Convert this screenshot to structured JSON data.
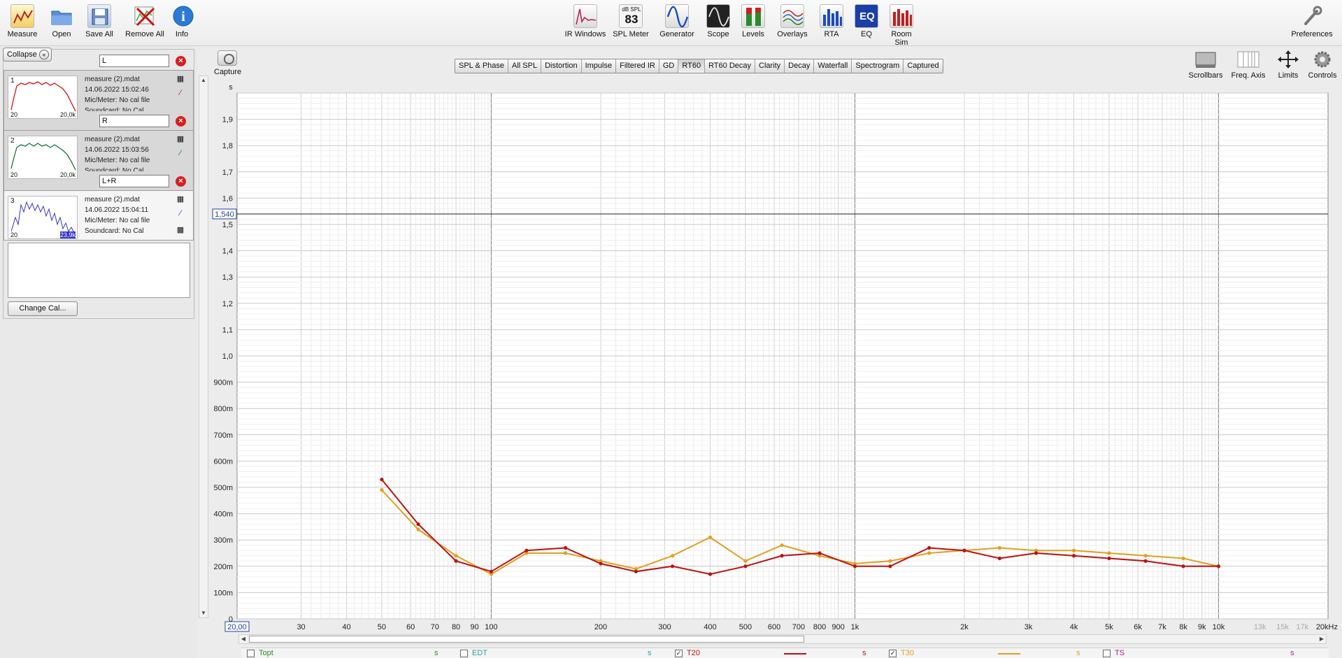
{
  "toolbar": {
    "left": [
      {
        "label": "Measure",
        "icon": "measure-icon"
      },
      {
        "label": "Open",
        "icon": "folder-icon"
      },
      {
        "label": "Save All",
        "icon": "save-icon"
      },
      {
        "label": "Remove All",
        "icon": "remove-all-icon"
      },
      {
        "label": "Info",
        "icon": "info-icon"
      }
    ],
    "center": [
      {
        "label": "IR Windows",
        "icon": "ir-windows-icon"
      },
      {
        "label": "SPL Meter",
        "icon": "spl-meter-icon",
        "badge_top": "dB SPL",
        "badge_value": "83"
      },
      {
        "label": "Generator",
        "icon": "generator-icon"
      },
      {
        "label": "Scope",
        "icon": "scope-icon"
      },
      {
        "label": "Levels",
        "icon": "levels-icon"
      },
      {
        "label": "Overlays",
        "icon": "overlays-icon"
      },
      {
        "label": "RTA",
        "icon": "rta-icon"
      },
      {
        "label": "EQ",
        "icon": "eq-icon"
      },
      {
        "label": "Room Sim",
        "icon": "room-sim-icon"
      }
    ],
    "preferences": "Preferences"
  },
  "left_panel": {
    "collapse_label": "Collapse",
    "measurements": [
      {
        "number": "1",
        "name": "L",
        "file": "measure (2).mdat",
        "date": "14.06.2022 15:02:46",
        "mic": "Mic/Meter: No cal file",
        "soundcard": "Soundcard: No Cal",
        "range_lo": "20",
        "range_hi": "20,0k",
        "color": "#cc1111"
      },
      {
        "number": "2",
        "name": "R",
        "file": "measure (2).mdat",
        "date": "14.06.2022 15:03:56",
        "mic": "Mic/Meter: No cal file",
        "soundcard": "Soundcard: No Cal",
        "range_lo": "20",
        "range_hi": "20,0k",
        "color": "#117733"
      },
      {
        "number": "3",
        "name": "L+R",
        "file": "measure (2).mdat",
        "date": "14.06.2022 15:04:11",
        "mic": "Mic/Meter: No cal file",
        "soundcard": "Soundcard: No Cal",
        "range_lo": "20",
        "range_hi": "23,9k",
        "color": "#3333cc"
      }
    ],
    "change_cal_label": "Change Cal..."
  },
  "capture_label": "Capture",
  "graph_tabs": [
    "SPL & Phase",
    "All SPL",
    "Distortion",
    "Impulse",
    "Filtered IR",
    "GD",
    "RT60",
    "RT60 Decay",
    "Clarity",
    "Decay",
    "Waterfall",
    "Spectrogram",
    "Captured"
  ],
  "selected_tab": "RT60",
  "right_controls": [
    {
      "label": "Scrollbars",
      "icon": "scrollbars-icon"
    },
    {
      "label": "Freq. Axis",
      "icon": "freq-axis-icon"
    },
    {
      "label": "Limits",
      "icon": "limits-icon"
    },
    {
      "label": "Controls",
      "icon": "controls-gear-icon"
    }
  ],
  "legend": [
    {
      "name": "Topt",
      "unit": "s",
      "checked": false,
      "color": "#2a8a2a"
    },
    {
      "name": "EDT",
      "unit": "s",
      "checked": false,
      "color": "#2aa0a0"
    },
    {
      "name": "T20",
      "unit": "s",
      "checked": true,
      "color": "#bb1111"
    },
    {
      "name": "T30",
      "unit": "s",
      "checked": true,
      "color": "#e0a020"
    },
    {
      "name": "TS",
      "unit": "s",
      "checked": false,
      "color": "#aa2288"
    }
  ],
  "chart_data": {
    "type": "line",
    "ylabel": "s",
    "x_scale": "log",
    "xlim": [
      20,
      20000
    ],
    "ylim": [
      0,
      2.0
    ],
    "cursor_value": "1,540",
    "cursor_y": 1.54,
    "x_start_label": "20,00",
    "x_ticks": [
      {
        "value": 30,
        "label": "30"
      },
      {
        "value": 40,
        "label": "40"
      },
      {
        "value": 50,
        "label": "50"
      },
      {
        "value": 60,
        "label": "60"
      },
      {
        "value": 70,
        "label": "70"
      },
      {
        "value": 80,
        "label": "80"
      },
      {
        "value": 90,
        "label": "90"
      },
      {
        "value": 100,
        "label": "100"
      },
      {
        "value": 200,
        "label": "200"
      },
      {
        "value": 300,
        "label": "300"
      },
      {
        "value": 400,
        "label": "400"
      },
      {
        "value": 500,
        "label": "500"
      },
      {
        "value": 600,
        "label": "600"
      },
      {
        "value": 700,
        "label": "700"
      },
      {
        "value": 800,
        "label": "800"
      },
      {
        "value": 900,
        "label": "900"
      },
      {
        "value": 1000,
        "label": "1k"
      },
      {
        "value": 2000,
        "label": "2k"
      },
      {
        "value": 3000,
        "label": "3k"
      },
      {
        "value": 4000,
        "label": "4k"
      },
      {
        "value": 5000,
        "label": "5k"
      },
      {
        "value": 6000,
        "label": "6k"
      },
      {
        "value": 7000,
        "label": "7k"
      },
      {
        "value": 8000,
        "label": "8k"
      },
      {
        "value": 9000,
        "label": "9k"
      },
      {
        "value": 10000,
        "label": "10k"
      },
      {
        "value": 13000,
        "label": "13k",
        "dim": true
      },
      {
        "value": 15000,
        "label": "15k",
        "dim": true
      },
      {
        "value": 17000,
        "label": "17k",
        "dim": true
      },
      {
        "value": 20000,
        "label": "20kHz"
      }
    ],
    "y_ticks": [
      {
        "value": 0,
        "label": "0"
      },
      {
        "value": 0.1,
        "label": "100m"
      },
      {
        "value": 0.2,
        "label": "200m"
      },
      {
        "value": 0.3,
        "label": "300m"
      },
      {
        "value": 0.4,
        "label": "400m"
      },
      {
        "value": 0.5,
        "label": "500m"
      },
      {
        "value": 0.6,
        "label": "600m"
      },
      {
        "value": 0.7,
        "label": "700m"
      },
      {
        "value": 0.8,
        "label": "800m"
      },
      {
        "value": 0.9,
        "label": "900m"
      },
      {
        "value": 1.0,
        "label": "1,0"
      },
      {
        "value": 1.1,
        "label": "1,1"
      },
      {
        "value": 1.2,
        "label": "1,2"
      },
      {
        "value": 1.3,
        "label": "1,3"
      },
      {
        "value": 1.4,
        "label": "1,4"
      },
      {
        "value": 1.5,
        "label": "1,5"
      },
      {
        "value": 1.6,
        "label": "1,6"
      },
      {
        "value": 1.7,
        "label": "1,7"
      },
      {
        "value": 1.8,
        "label": "1,8"
      },
      {
        "value": 1.9,
        "label": "1,9"
      }
    ],
    "x": [
      50,
      63,
      80,
      100,
      125,
      160,
      200,
      250,
      315,
      400,
      500,
      630,
      800,
      1000,
      1250,
      1600,
      2000,
      2500,
      3150,
      4000,
      5000,
      6300,
      8000,
      10000
    ],
    "series": [
      {
        "name": "T20",
        "color": "#bb1111",
        "values": [
          0.53,
          0.36,
          0.22,
          0.18,
          0.26,
          0.27,
          0.21,
          0.18,
          0.2,
          0.17,
          0.2,
          0.24,
          0.25,
          0.2,
          0.2,
          0.27,
          0.26,
          0.23,
          0.25,
          0.24,
          0.23,
          0.22,
          0.2,
          0.2
        ]
      },
      {
        "name": "T30",
        "color": "#e0a020",
        "values": [
          0.49,
          0.34,
          0.24,
          0.17,
          0.25,
          0.25,
          0.22,
          0.19,
          0.24,
          0.31,
          0.22,
          0.28,
          0.24,
          0.21,
          0.22,
          0.25,
          0.26,
          0.27,
          0.26,
          0.26,
          0.25,
          0.24,
          0.23,
          0.2
        ]
      }
    ]
  }
}
